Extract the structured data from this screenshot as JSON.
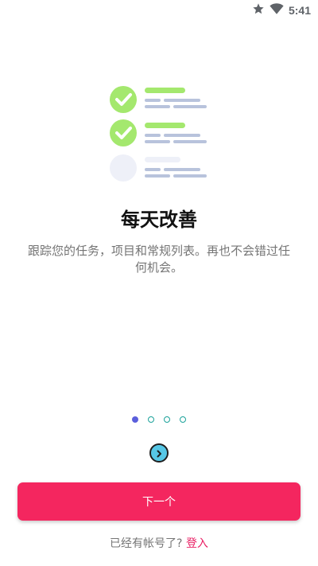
{
  "status_bar": {
    "time": "5:41",
    "icons": [
      "star-icon",
      "wifi-icon"
    ]
  },
  "onboarding": {
    "title": "每天改善",
    "subtitle": "跟踪您的任务，项目和常规列表。再也不会错过任何机会。",
    "page_indicator": {
      "current": 1,
      "total": 4
    },
    "illustration": {
      "items": [
        "checked",
        "checked",
        "unchecked"
      ]
    }
  },
  "actions": {
    "next_label": "下一个",
    "login_prompt": "已经有帐号了?",
    "login_link": "登入"
  },
  "colors": {
    "primary": "#f4265f",
    "dot_active": "#5b5fdc",
    "dot_inactive": "#1ba29a",
    "check_green": "#a4e86e",
    "login_link": "#e91e63"
  }
}
